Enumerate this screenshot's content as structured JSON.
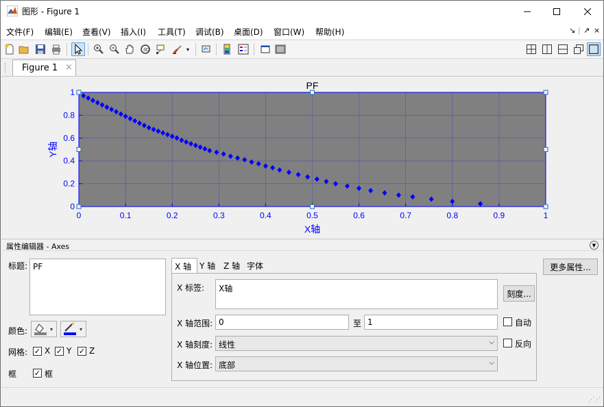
{
  "window": {
    "title": "图形 - Figure 1",
    "minimize_icon": "minimize-icon",
    "maximize_icon": "maximize-icon",
    "close_icon": "close-icon"
  },
  "menu": {
    "items": [
      "文件(F)",
      "编辑(E)",
      "查看(V)",
      "插入(I)",
      "工具(T)",
      "调试(B)",
      "桌面(D)",
      "窗口(W)",
      "帮助(H)"
    ],
    "right_icons": [
      "dock-icon",
      "undock-icon",
      "close-icon"
    ]
  },
  "toolbar": {
    "left_icons": [
      "new-figure-icon",
      "open-icon",
      "save-icon",
      "print-icon",
      "select-pointer-icon",
      "zoom-in-icon",
      "zoom-out-icon",
      "pan-icon",
      "rotate-3d-icon",
      "data-cursor-icon",
      "brush-icon",
      "brush-dropdown-icon",
      "link-plot-icon",
      "colorbar-icon",
      "legend-icon",
      "hide-plot-tools-icon",
      "show-plot-tools-icon"
    ],
    "right_icons": [
      "tile-2x2-icon",
      "tile-columns-icon",
      "tile-rows-icon",
      "float-icon",
      "maximize-plot-icon"
    ]
  },
  "figure_tab": {
    "label": "Figure 1",
    "close_symbol": "×"
  },
  "chart_data": {
    "type": "scatter",
    "title": "PF",
    "xlabel": "X轴",
    "ylabel": "Y轴",
    "xlim": [
      0,
      1
    ],
    "ylim": [
      0,
      1
    ],
    "xticks": [
      "0",
      "0.1",
      "0.2",
      "0.3",
      "0.4",
      "0.5",
      "0.6",
      "0.7",
      "0.8",
      "0.9",
      "1"
    ],
    "yticks": [
      "0",
      "0.2",
      "0.4",
      "0.6",
      "0.8",
      "1"
    ],
    "grid": true,
    "background": "#808080",
    "marker_color": "#0000ff",
    "marker": "diamond",
    "series": [
      {
        "x": [
          0,
          0.01,
          0.02,
          0.03,
          0.04,
          0.05,
          0.06,
          0.07,
          0.08,
          0.09,
          0.1,
          0.11,
          0.12,
          0.13,
          0.14,
          0.15,
          0.16,
          0.17,
          0.18,
          0.19,
          0.2,
          0.21,
          0.22,
          0.23,
          0.24,
          0.25,
          0.26,
          0.27,
          0.28,
          0.295,
          0.31,
          0.325,
          0.34,
          0.355,
          0.37,
          0.385,
          0.4,
          0.415,
          0.43,
          0.45,
          0.47,
          0.49,
          0.51,
          0.53,
          0.55,
          0.575,
          0.6,
          0.625,
          0.655,
          0.685,
          0.715,
          0.755,
          0.8,
          0.86,
          1.0
        ],
        "y": [
          1.0,
          0.97,
          0.95,
          0.93,
          0.91,
          0.89,
          0.87,
          0.85,
          0.83,
          0.81,
          0.79,
          0.77,
          0.75,
          0.73,
          0.71,
          0.69,
          0.675,
          0.66,
          0.645,
          0.63,
          0.615,
          0.6,
          0.58,
          0.565,
          0.55,
          0.535,
          0.52,
          0.505,
          0.49,
          0.475,
          0.46,
          0.44,
          0.425,
          0.41,
          0.39,
          0.375,
          0.355,
          0.34,
          0.32,
          0.3,
          0.28,
          0.26,
          0.24,
          0.22,
          0.2,
          0.18,
          0.16,
          0.14,
          0.12,
          0.1,
          0.085,
          0.065,
          0.045,
          0.025,
          0.0
        ]
      }
    ]
  },
  "property_editor": {
    "header": "属性编辑器 - Axes",
    "title_label": "标题:",
    "title_value": "PF",
    "color_label": "颜色:",
    "color_icons": [
      "fill-color-icon",
      "line-color-icon"
    ],
    "grid_label": "网格:",
    "grid_x": "X",
    "grid_y": "Y",
    "grid_z": "Z",
    "box_label": "框",
    "box_check": "框",
    "tabs": [
      "X 轴",
      "Y 轴",
      "Z 轴",
      "字体"
    ],
    "x_label_label": "X 标签:",
    "x_label_value": "X轴",
    "ticks_button": "刻度...",
    "x_range_label": "X 轴范围:",
    "x_range_min": "0",
    "x_range_to": "至",
    "x_range_max": "1",
    "auto_label": "自动",
    "x_scale_label": "X 轴刻度:",
    "x_scale_value": "线性",
    "reverse_label": "反向",
    "x_location_label": "X 轴位置:",
    "x_location_value": "底部",
    "more_button": "更多属性..."
  }
}
